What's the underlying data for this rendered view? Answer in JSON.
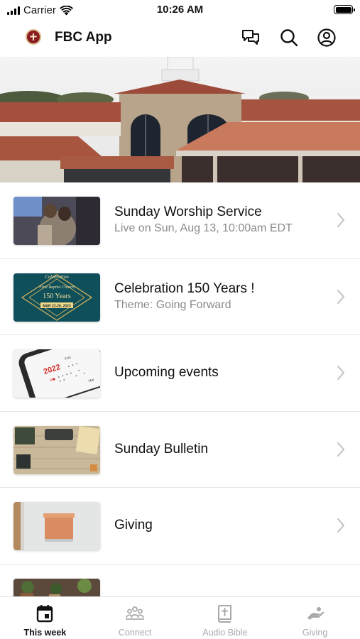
{
  "status_bar": {
    "carrier": "Carrier",
    "time": "10:26 AM"
  },
  "header": {
    "title": "FBC App",
    "icons": [
      "chat-bubbles-icon",
      "search-icon",
      "account-icon"
    ]
  },
  "hero": {
    "image": "church-building-photo"
  },
  "feed": {
    "items": [
      {
        "title": "Sunday Worship Service",
        "subtitle": "Live on Sun, Aug 13, 10:00am EDT",
        "thumbnail": "worship-embrace-photo"
      },
      {
        "title": "Celebration 150 Years !",
        "subtitle": "Theme: Going Forward",
        "thumbnail": "celebration-banner",
        "thumbnail_text": {
          "line1": "Celebration",
          "line2": "First Baptist Church",
          "line3": "150 Years",
          "line4": "MAR 22-26, 2023"
        }
      },
      {
        "title": "Upcoming events",
        "subtitle": "",
        "thumbnail": "calendar-phone-photo",
        "thumbnail_text": {
          "year": "2022",
          "month1": "Jan",
          "month2": "Feb",
          "month3": "Mar"
        }
      },
      {
        "title": "Sunday Bulletin",
        "subtitle": "",
        "thumbnail": "desk-typewriter-photo"
      },
      {
        "title": "Giving",
        "subtitle": "",
        "thumbnail": "mailbox-photo"
      },
      {
        "title": "",
        "subtitle": "",
        "thumbnail": "plants-photo"
      }
    ]
  },
  "tab_bar": {
    "tabs": [
      {
        "label": "This week",
        "icon": "calendar-icon",
        "active": true
      },
      {
        "label": "Connect",
        "icon": "people-group-icon",
        "active": false
      },
      {
        "label": "Audio Bible",
        "icon": "bible-icon",
        "active": false
      },
      {
        "label": "Giving",
        "icon": "giving-hand-icon",
        "active": false
      }
    ]
  },
  "colors": {
    "active_tab": "#111111",
    "inactive_tab": "#a9a9a9",
    "subtitle": "#8a8a8a",
    "chevron": "#c7c7cc"
  }
}
